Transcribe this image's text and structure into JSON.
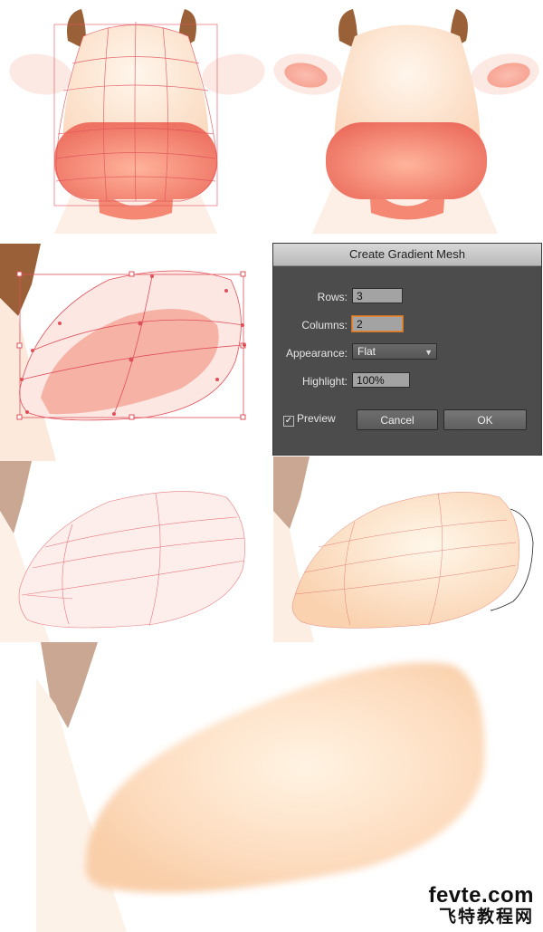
{
  "dialog": {
    "title": "Create Gradient Mesh",
    "rows_label": "Rows:",
    "rows_value": "3",
    "columns_label": "Columns:",
    "columns_value": "2",
    "appearance_label": "Appearance:",
    "appearance_value": "Flat",
    "highlight_label": "Highlight:",
    "highlight_value": "100%",
    "preview_label": "Preview",
    "preview_checked": true,
    "cancel_label": "Cancel",
    "ok_label": "OK"
  },
  "watermark": {
    "line1": "fevte.com",
    "line2": "飞特教程网"
  },
  "colors": {
    "horn": "#9a6138",
    "face": "#fde3cc",
    "nose": "#f2816e",
    "mesh_line": "#e0505a",
    "dialog_bg": "#4c4c4c",
    "focus": "#e08a3a"
  }
}
